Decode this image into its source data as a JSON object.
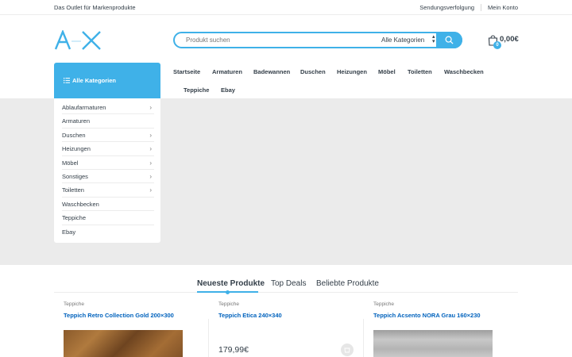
{
  "topbar": {
    "tagline": "Das Outlet für Markenprodukte",
    "links": [
      "Sendungsverfolgung",
      "Mein Konto"
    ]
  },
  "header": {
    "logo_text": "AX",
    "search": {
      "placeholder": "Produkt suchen",
      "category_selected": "Alle Kategorien"
    },
    "cart": {
      "count": "0",
      "total": "0,00€"
    }
  },
  "categories": {
    "heading": "Alle Kategorien",
    "items": [
      {
        "label": "Ablaufarmaturen",
        "has_children": true
      },
      {
        "label": "Armaturen",
        "has_children": false
      },
      {
        "label": "Duschen",
        "has_children": true
      },
      {
        "label": "Heizungen",
        "has_children": true
      },
      {
        "label": "Möbel",
        "has_children": true
      },
      {
        "label": "Sonstiges",
        "has_children": true
      },
      {
        "label": "Toiletten",
        "has_children": true
      },
      {
        "label": "Waschbecken",
        "has_children": false
      },
      {
        "label": "Teppiche",
        "has_children": false
      },
      {
        "label": "Ebay",
        "has_children": false
      }
    ]
  },
  "nav": {
    "items": [
      "Startseite",
      "Armaturen",
      "Badewannen",
      "Duschen",
      "Heizungen",
      "Möbel",
      "Toiletten",
      "Waschbecken",
      "Teppiche",
      "Ebay"
    ]
  },
  "tabs": {
    "items": [
      "Neueste Produkte",
      "Top Deals",
      "Beliebte Produkte"
    ],
    "active": 0
  },
  "products": [
    {
      "category": "Teppiche",
      "name": "Teppich Retro Collection Gold 200×300",
      "price": ""
    },
    {
      "category": "Teppiche",
      "name": "Teppich Etica 240×340",
      "price": "179,99€"
    },
    {
      "category": "Teppiche",
      "name": "Teppich Acsento NORA Grau 160×230",
      "price": ""
    }
  ],
  "colors": {
    "accent": "#3fb1e8",
    "text": "#333e48",
    "link": "#0062bd",
    "hero_bg": "#ebebeb"
  }
}
